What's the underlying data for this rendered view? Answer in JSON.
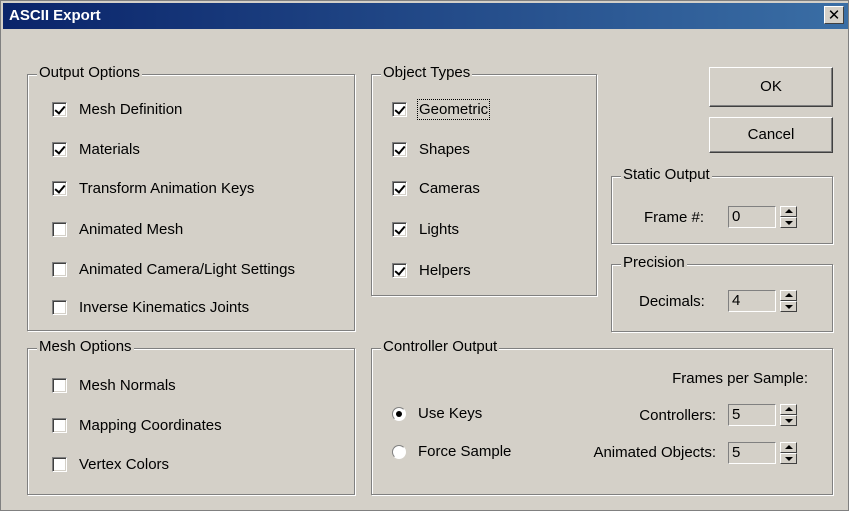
{
  "window": {
    "title": "ASCII Export",
    "close_symbol": "✕"
  },
  "output_options": {
    "legend": "Output Options",
    "items": [
      {
        "label": "Mesh Definition",
        "checked": true
      },
      {
        "label": "Materials",
        "checked": true
      },
      {
        "label": "Transform Animation Keys",
        "checked": true
      },
      {
        "label": "Animated Mesh",
        "checked": false
      },
      {
        "label": "Animated Camera/Light Settings",
        "checked": false
      },
      {
        "label": "Inverse Kinematics Joints",
        "checked": false
      }
    ]
  },
  "mesh_options": {
    "legend": "Mesh Options",
    "items": [
      {
        "label": "Mesh Normals",
        "checked": false
      },
      {
        "label": "Mapping Coordinates",
        "checked": false
      },
      {
        "label": "Vertex Colors",
        "checked": false
      }
    ]
  },
  "object_types": {
    "legend": "Object Types",
    "items": [
      {
        "label": "Geometric",
        "checked": true
      },
      {
        "label": "Shapes",
        "checked": true
      },
      {
        "label": "Cameras",
        "checked": true
      },
      {
        "label": "Lights",
        "checked": true
      },
      {
        "label": "Helpers",
        "checked": true
      }
    ]
  },
  "buttons": {
    "ok": "OK",
    "cancel": "Cancel"
  },
  "static_output": {
    "legend": "Static Output",
    "frame_label": "Frame #:",
    "frame_value": "0"
  },
  "precision": {
    "legend": "Precision",
    "decimals_label": "Decimals:",
    "decimals_value": "4"
  },
  "controller_output": {
    "legend": "Controller Output",
    "frames_per_sample_label": "Frames per Sample:",
    "use_keys": "Use Keys",
    "force_sample": "Force Sample",
    "selected_mode": "use_keys",
    "controllers_label": "Controllers:",
    "controllers_value": "5",
    "animated_objects_label": "Animated Objects:",
    "animated_objects_value": "5"
  }
}
